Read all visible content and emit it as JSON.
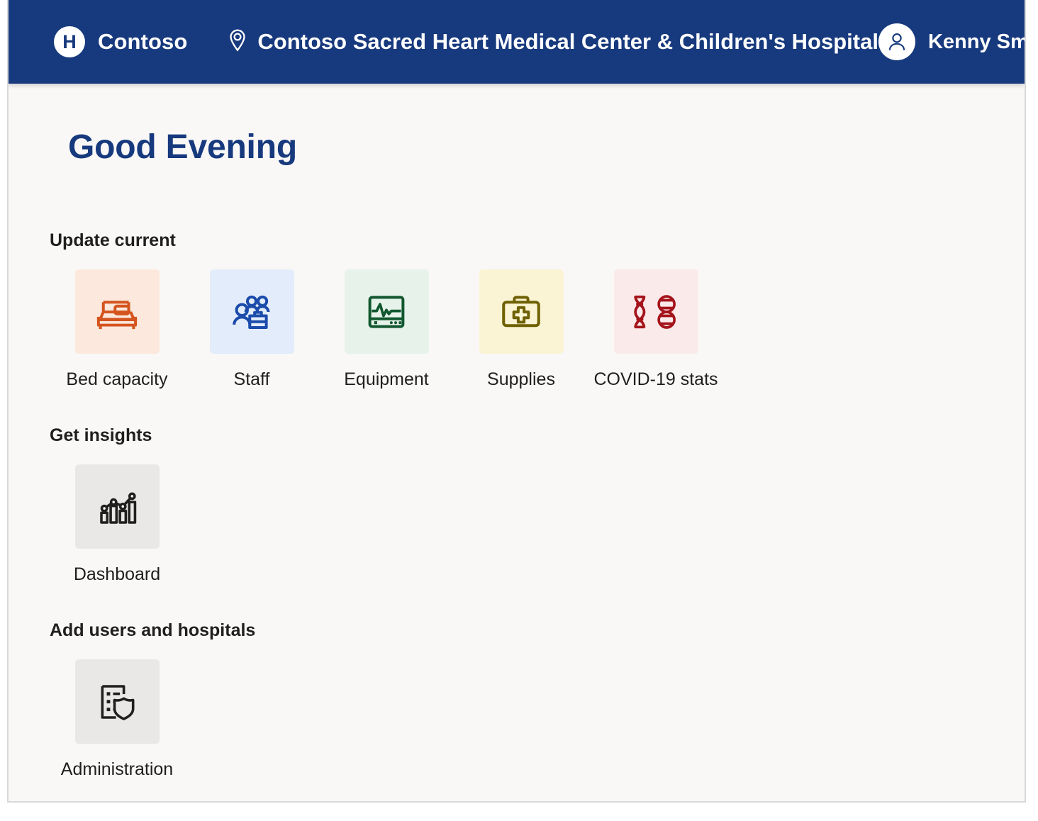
{
  "header": {
    "logo_letter": "H",
    "brand_name": "Contoso",
    "location_icon": "location-pin-icon",
    "site_name": "Contoso Sacred Heart Medical Center & Children's Hospital",
    "user_name": "Kenny Smith",
    "avatar_icon": "user-avatar-icon",
    "background_color": "#17397d"
  },
  "main": {
    "greeting": "Good Evening",
    "greeting_color": "#17397d",
    "sections": [
      {
        "title": "Update current",
        "tiles": [
          {
            "label": "Bed capacity",
            "icon": "bed-icon",
            "icon_color": "#d4541e",
            "tile_color": "#fce8dc"
          },
          {
            "label": "Staff",
            "icon": "staff-people-icon",
            "icon_color": "#1b4bab",
            "tile_color": "#e3ecfa"
          },
          {
            "label": "Equipment",
            "icon": "ekg-monitor-icon",
            "icon_color": "#12572f",
            "tile_color": "#e6f2ea"
          },
          {
            "label": "Supplies",
            "icon": "first-aid-kit-icon",
            "icon_color": "#6e6003",
            "tile_color": "#fbf4d4"
          },
          {
            "label": "COVID-19 stats",
            "icon": "dna-helix-icon",
            "icon_color": "#a4141b",
            "tile_color": "#fbeaea"
          }
        ]
      },
      {
        "title": "Get insights",
        "tiles": [
          {
            "label": "Dashboard",
            "icon": "bar-chart-icon",
            "icon_color": "#201f1e",
            "tile_color": "#e9e8e7"
          }
        ]
      },
      {
        "title": "Add users and hospitals",
        "tiles": [
          {
            "label": "Administration",
            "icon": "list-shield-icon",
            "icon_color": "#201f1e",
            "tile_color": "#e9e8e7"
          }
        ]
      }
    ]
  }
}
